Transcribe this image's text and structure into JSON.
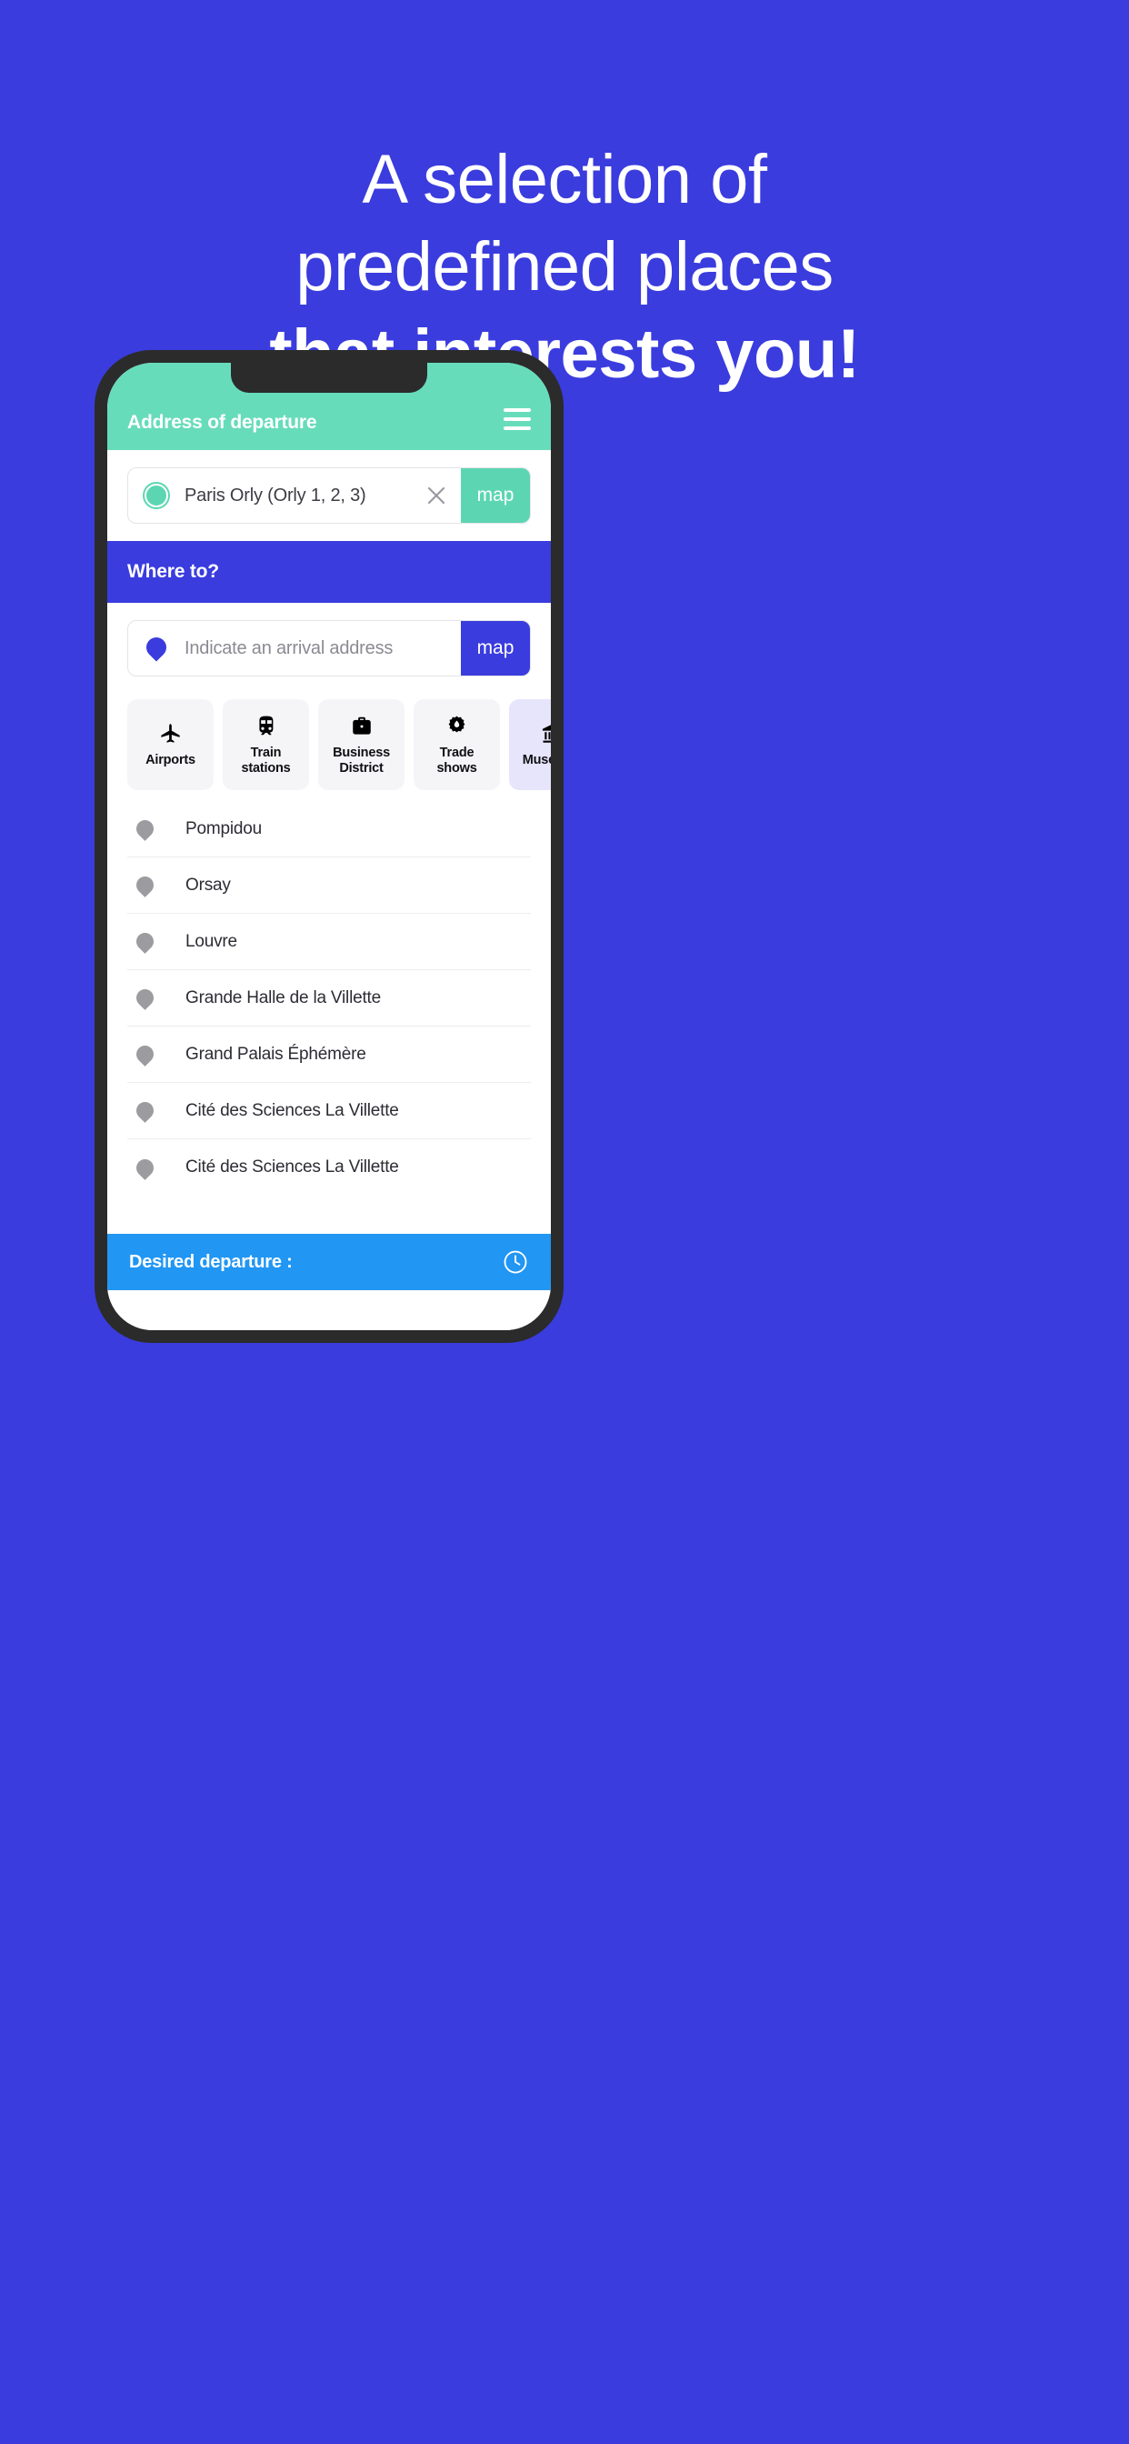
{
  "background_color": "#3A3CDE",
  "headline": {
    "line1": "A selection of",
    "line2": "predefined places",
    "line3": "that interests you!"
  },
  "phone": {
    "appbar": {
      "title": "Address of departure",
      "background_color": "#67DCBB",
      "menu_icon": "hamburger-menu-icon"
    },
    "departure_field": {
      "icon": "circle-marker-icon",
      "value": "Paris Orly (Orly 1, 2, 3)",
      "clear_icon": "close-x-icon",
      "map_button_label": "map",
      "map_button_color": "#5CD6B2"
    },
    "where_to_banner": {
      "title": "Where to?",
      "background_color": "#3A3CDE"
    },
    "arrival_field": {
      "icon": "location-pin-icon",
      "placeholder": "Indicate an arrival address",
      "value": "",
      "map_button_label": "map",
      "map_button_color": "#3A3CDE"
    },
    "categories": [
      {
        "label": "Airports",
        "icon": "airplane-icon",
        "active": false
      },
      {
        "label": "Train\nstations",
        "icon": "train-icon",
        "active": false
      },
      {
        "label": "Business\nDistrict",
        "icon": "briefcase-icon",
        "active": false
      },
      {
        "label": "Trade\nshows",
        "icon": "rosette-badge-icon",
        "active": false
      },
      {
        "label": "Museums",
        "icon": "museum-bank-icon",
        "active": true
      }
    ],
    "places": [
      {
        "name": "Pompidou",
        "icon": "location-pin-icon"
      },
      {
        "name": "Orsay",
        "icon": "location-pin-icon"
      },
      {
        "name": "Louvre",
        "icon": "location-pin-icon"
      },
      {
        "name": "Grande Halle de la Villette",
        "icon": "location-pin-icon"
      },
      {
        "name": "Grand Palais Éphémère",
        "icon": "location-pin-icon"
      },
      {
        "name": "Cité des Sciences La Villette",
        "icon": "location-pin-icon"
      },
      {
        "name": "Cité des Sciences La Villette",
        "icon": "location-pin-icon"
      }
    ],
    "bottom_bar": {
      "label": "Desired departure :",
      "icon": "clock-icon",
      "background_color": "#2196F3"
    }
  }
}
